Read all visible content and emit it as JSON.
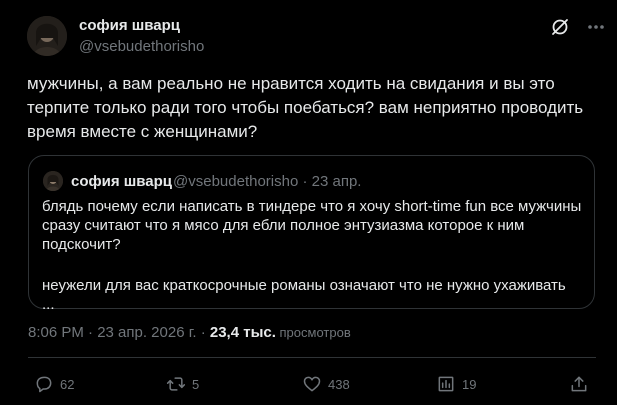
{
  "author": {
    "display_name": "софия шварц",
    "handle": "@vsebudethorisho"
  },
  "tweet": {
    "text": "мужчины, а вам реально не нравится ходить на свидания и вы это терпите только ради того чтобы поебаться? вам неприятно проводить время вместе с женщинами?"
  },
  "quote": {
    "display_name": "софия шварц",
    "handle_date": "@vsebudethorisho · 23 апр.",
    "text_p1": "блядь почему если написать в тиндере что я хочу short-time fun все мужчины сразу считают что я мясо для ебли полное энтузиазма которое к ним подскочит?",
    "text_p2": "неужели для вас краткосрочные романы означают что не нужно ухаживать ..."
  },
  "meta": {
    "timestamp": "8:06 PM · 23 апр. 2026 г. · ",
    "views_count": "23,4 тыс.",
    "views_label": " просмотров"
  },
  "actions": {
    "replies": "62",
    "reposts": "5",
    "likes": "438",
    "bookmarks": "19"
  },
  "icons": {
    "header": [
      "grok-icon",
      "more-icon"
    ],
    "actions": [
      "reply-icon",
      "repost-icon",
      "like-icon",
      "bookmark-icon",
      "share-icon"
    ]
  },
  "colors": {
    "background": "#000000",
    "text_primary": "#e7e9ea",
    "text_secondary": "#71767b",
    "border": "#2f3336"
  }
}
